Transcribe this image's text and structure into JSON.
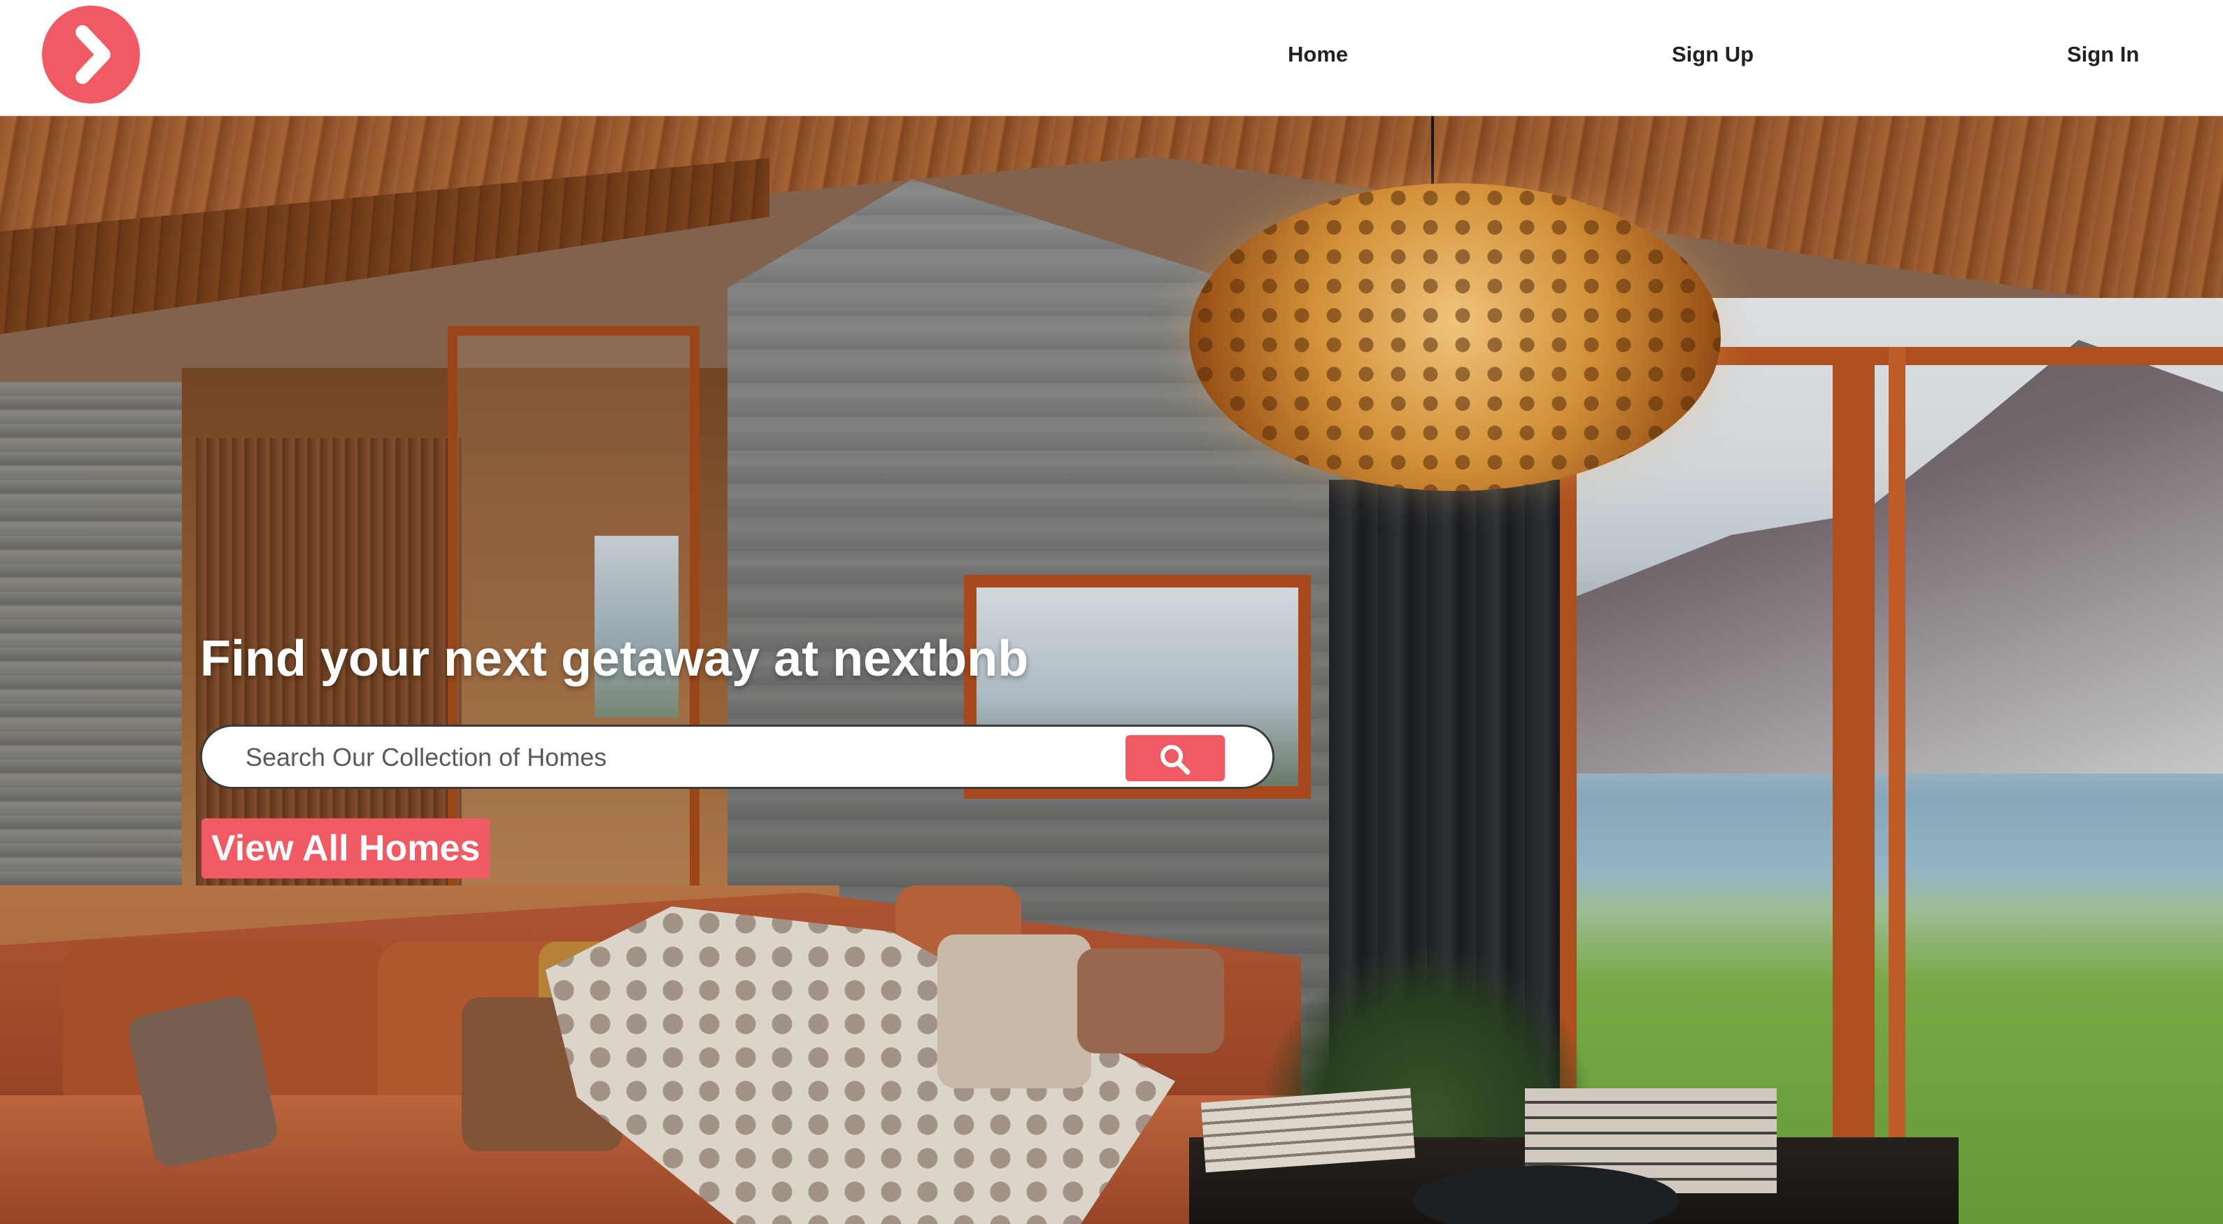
{
  "header": {
    "logo_icon": "chevron-right-icon",
    "nav": {
      "home": "Home",
      "sign_up": "Sign Up",
      "sign_in": "Sign In"
    }
  },
  "hero": {
    "title": "Find your next getaway at nextbnb",
    "search": {
      "placeholder": "Search Our Collection of Homes",
      "value": "",
      "button_icon": "search-icon"
    },
    "view_all_label": "View All Homes"
  },
  "colors": {
    "brand": "#f25a63",
    "nav_text": "#222222",
    "header_bg": "#ffffff"
  }
}
